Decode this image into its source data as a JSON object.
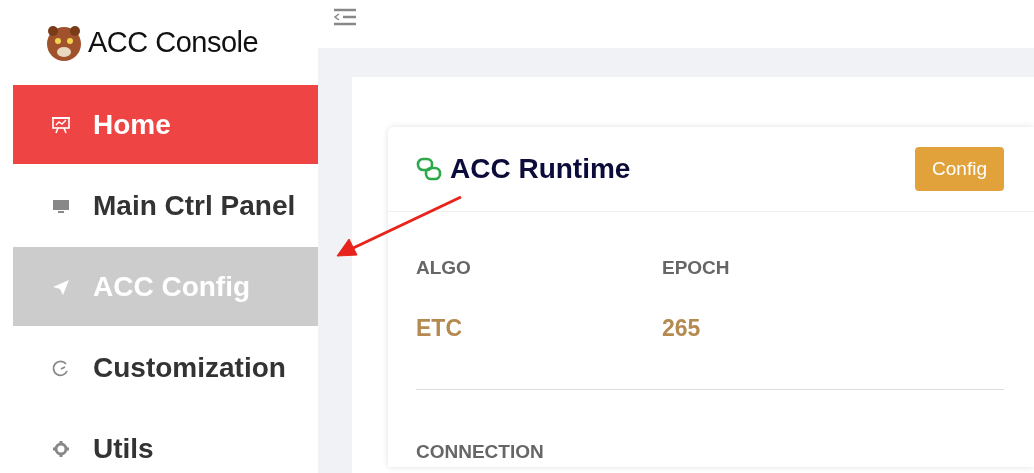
{
  "brand": {
    "title": "ACC Console"
  },
  "sidebar": {
    "items": [
      {
        "label": "Home",
        "kind": "chart",
        "selected": true,
        "hovered": false
      },
      {
        "label": "Main Ctrl Panel",
        "kind": "monitor",
        "selected": false,
        "hovered": false
      },
      {
        "label": "ACC Config",
        "kind": "plane",
        "selected": false,
        "hovered": true
      },
      {
        "label": "Customization",
        "kind": "gauge",
        "selected": false,
        "hovered": false
      },
      {
        "label": "Utils",
        "kind": "gear",
        "selected": false,
        "hovered": false
      }
    ]
  },
  "card": {
    "title": "ACC Runtime",
    "button": "Config",
    "stats": [
      {
        "label": "ALGO",
        "value": "ETC"
      },
      {
        "label": "EPOCH",
        "value": "265"
      }
    ],
    "section": "CONNECTION"
  }
}
